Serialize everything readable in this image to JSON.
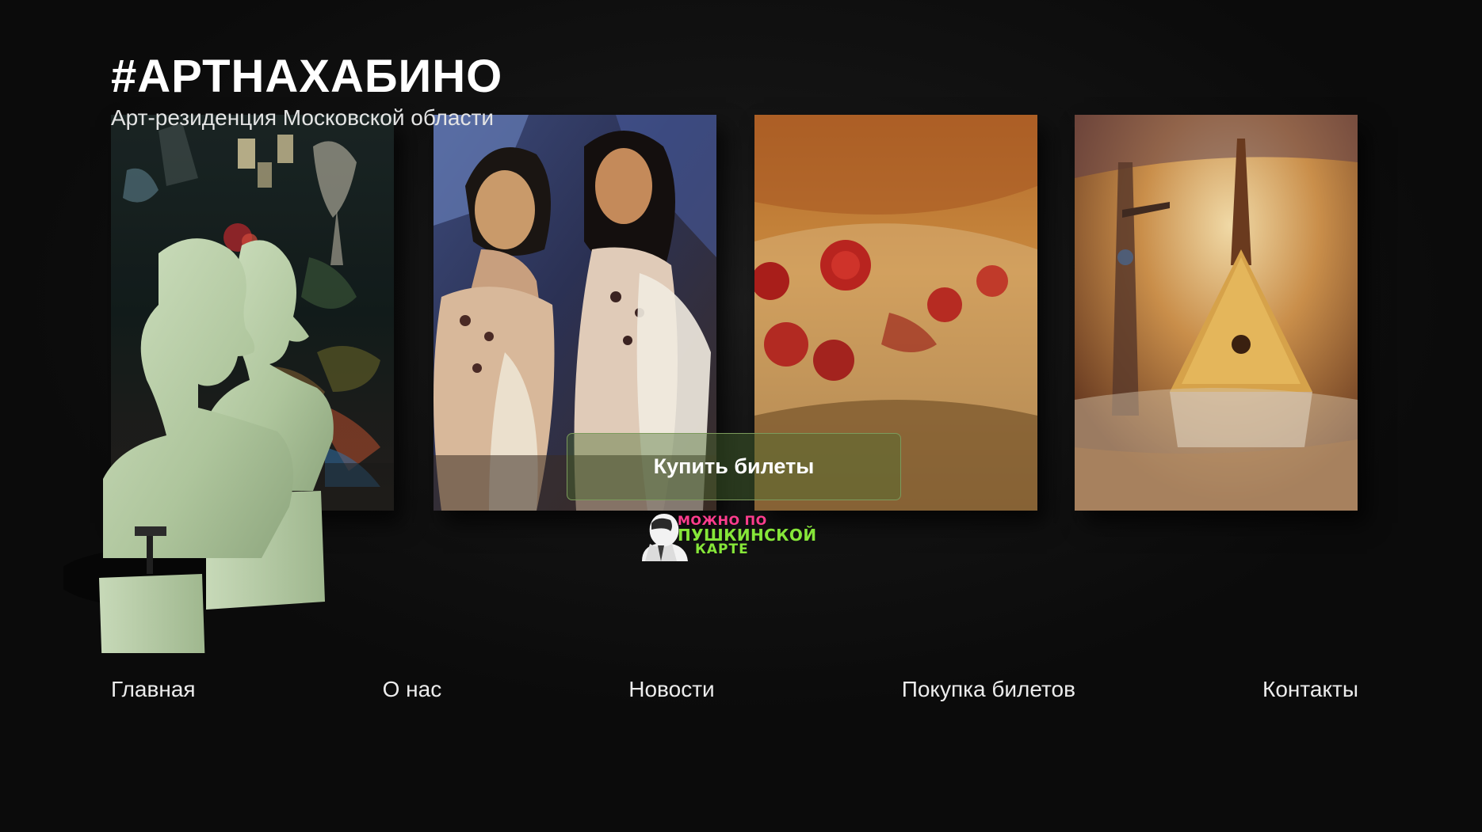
{
  "header": {
    "title": "#АРТНАХАБИНО",
    "subtitle": "Арт-резиденция Московской области"
  },
  "paintings": [
    {
      "icon": "painting-dark-interior"
    },
    {
      "icon": "painting-two-women"
    },
    {
      "icon": "painting-pizza"
    },
    {
      "icon": "painting-balalaika"
    }
  ],
  "cta": {
    "label": "Купить билеты"
  },
  "pushkin_badge": {
    "line1": "можно по",
    "line2": "пушкинской",
    "line3": "карте",
    "colors": {
      "pink": "#ff3d8e",
      "green": "#86e639"
    }
  },
  "nav": {
    "items": [
      {
        "label": "Главная"
      },
      {
        "label": "О нас"
      },
      {
        "label": "Новости"
      },
      {
        "label": "Покупка билетов"
      },
      {
        "label": "Контакты"
      }
    ]
  },
  "colors": {
    "background": "#0c0c0c",
    "cta_border": "#7c9b5c",
    "bust": "#b9cfa9"
  }
}
